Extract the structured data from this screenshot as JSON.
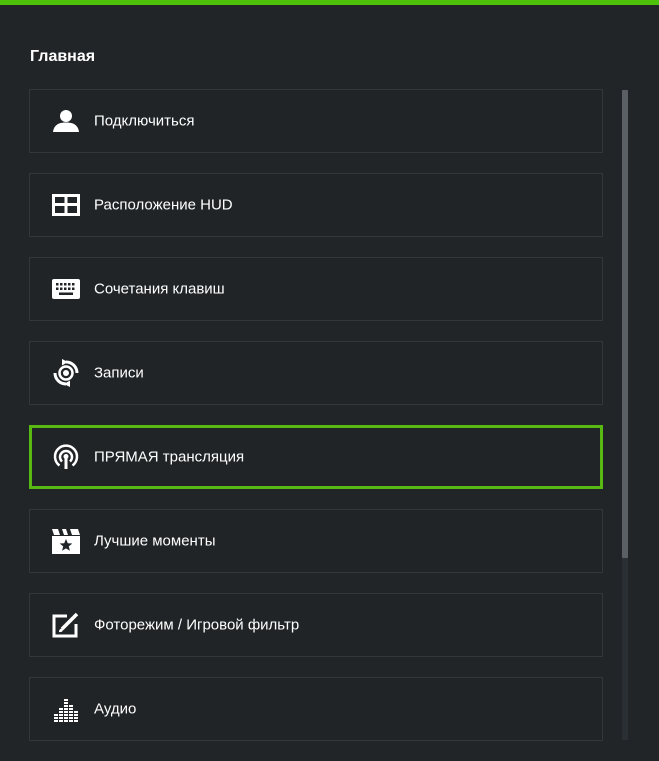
{
  "header": {
    "title": "Главная"
  },
  "menu": {
    "items": [
      {
        "label": "Подключиться",
        "icon": "user-icon"
      },
      {
        "label": "Расположение HUD",
        "icon": "layout-grid-icon"
      },
      {
        "label": "Сочетания клавиш",
        "icon": "keyboard-icon"
      },
      {
        "label": "Записи",
        "icon": "record-refresh-icon"
      },
      {
        "label": "ПРЯМАЯ трансляция",
        "icon": "broadcast-icon",
        "selected": true
      },
      {
        "label": "Лучшие моменты",
        "icon": "clapperboard-star-icon"
      },
      {
        "label": "Фоторежим / Игровой фильтр",
        "icon": "photo-edit-icon"
      },
      {
        "label": "Аудио",
        "icon": "equalizer-icon"
      }
    ]
  },
  "colors": {
    "accent": "#4ec10a",
    "selected_border": "#57b912",
    "background": "#212528",
    "item_border": "#31373b"
  }
}
